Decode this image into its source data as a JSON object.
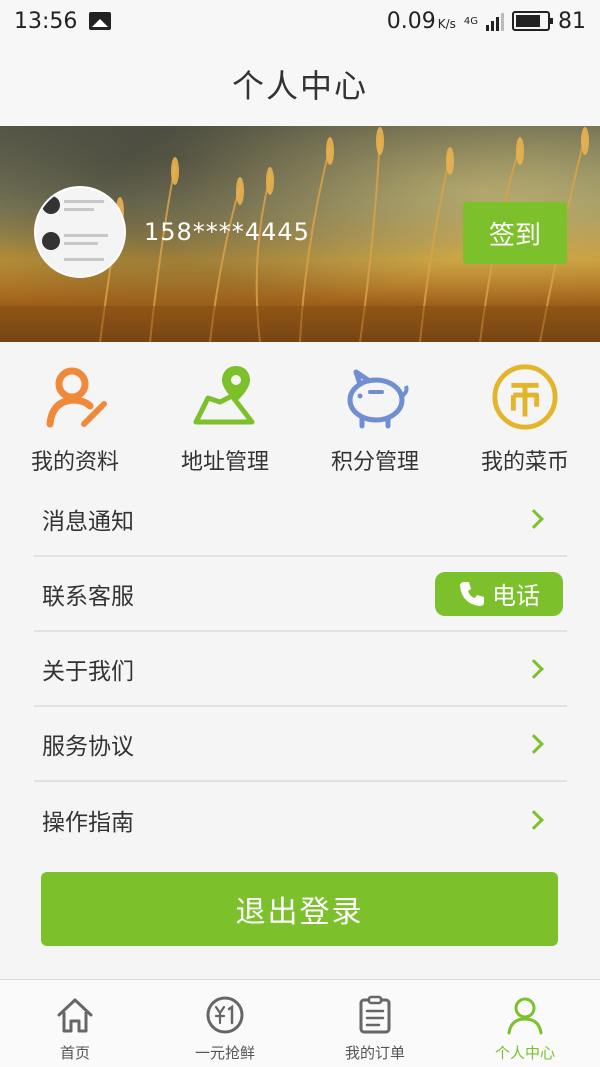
{
  "status_bar": {
    "time": "13:56",
    "net_speed": "0.09",
    "net_unit": "K/s",
    "network_type": "4G",
    "battery": "81"
  },
  "header": {
    "title": "个人中心"
  },
  "profile": {
    "phone": "158****4445",
    "checkin_label": "签到"
  },
  "quick_actions": [
    {
      "label": "我的资料",
      "icon": "profile-edit-icon"
    },
    {
      "label": "地址管理",
      "icon": "map-pin-icon"
    },
    {
      "label": "积分管理",
      "icon": "piggy-bank-icon"
    },
    {
      "label": "我的菜币",
      "icon": "coin-icon"
    }
  ],
  "menu": {
    "items": [
      {
        "label": "消息通知"
      },
      {
        "label": "联系客服",
        "button": "电话"
      },
      {
        "label": "关于我们"
      },
      {
        "label": "服务协议"
      },
      {
        "label": "操作指南"
      }
    ]
  },
  "logout_label": "退出登录",
  "tabs": [
    {
      "label": "首页",
      "icon": "home-icon"
    },
    {
      "label": "一元抢鲜",
      "icon": "yuan-coin-icon"
    },
    {
      "label": "我的订单",
      "icon": "order-list-icon"
    },
    {
      "label": "个人中心",
      "icon": "user-icon"
    }
  ],
  "colors": {
    "accent": "#7cc12c",
    "orange": "#f08a3a",
    "blue": "#6f8fd2",
    "gold": "#e3b52a"
  }
}
